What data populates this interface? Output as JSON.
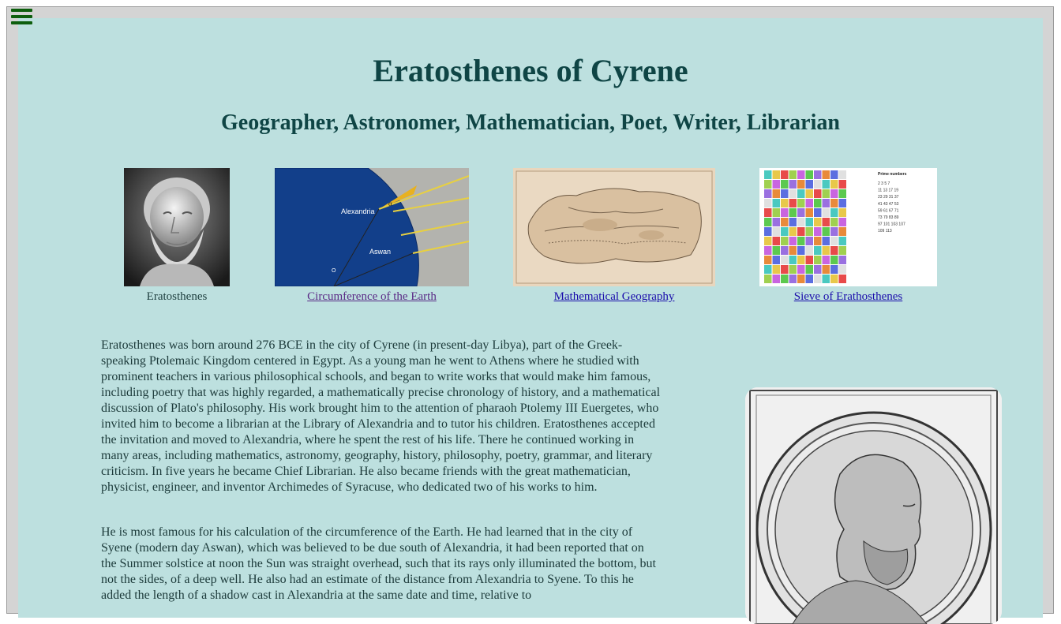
{
  "menu": {
    "icon": "hamburger-menu-icon"
  },
  "header": {
    "title": "Eratosthenes of Cyrene",
    "subtitle": "Geographer, Astronomer, Mathematician, Poet, Writer, Librarian"
  },
  "figures": {
    "bust": {
      "caption": "Eratosthenes"
    },
    "circumference": {
      "caption": "Circumference of the Earth",
      "label_alexandria": "Alexandria",
      "label_aswan": "Aswan",
      "label_angle": "α",
      "label_center": "O"
    },
    "geography": {
      "caption": "Mathematical Geography"
    },
    "sieve": {
      "caption": "Sieve of Erathosthenes",
      "heading": "Prime numbers",
      "primes_lines": [
        "2   3   5   7",
        "11  13  17  19",
        "23  29  31  37",
        "41  43  47  53",
        "59  61  67  71",
        "73  79  83  89",
        "97  101 103 107",
        "109 113"
      ]
    }
  },
  "paragraphs": {
    "p1": "Eratosthenes was born around 276 BCE in the city of Cyrene (in present-day Libya), part of the Greek-speaking Ptolemaic Kingdom centered in Egypt. As a young man he went to Athens where he studied with prominent teachers in various philosophical schools, and began to write works that would make him famous, including poetry that was highly regarded, a mathematically precise chronology of history, and a mathematical discussion of Plato's philosophy. His work brought him to the attention of pharaoh Ptolemy III Euergetes, who invited him to become a librarian at the Library of Alexandria and to tutor his children. Eratosthenes accepted the invitation and moved to Alexandria, where he spent the rest of his life. There he continued working in many areas, including mathematics, astronomy, geography, history, philosophy, poetry, grammar, and literary criticism. In five years he became Chief Librarian. He also became friends with the great mathematician, physicist, engineer, and inventor Archimedes of Syracuse, who dedicated two of his works to him.",
    "p2": "He is most famous for his calculation of the circumference of the Earth. He had learned that in the city of Syene (modern day Aswan), which was believed to be due south of Alexandria, it had been reported that on the Summer solstice at noon the Sun was straight overhead, such that its rays only illuminated the bottom, but not the sides, of a deep well. He also had an estimate of the distance from Alexandria to Syene. To this he added the length of a shadow cast in Alexandria at the same date and time, relative to"
  }
}
